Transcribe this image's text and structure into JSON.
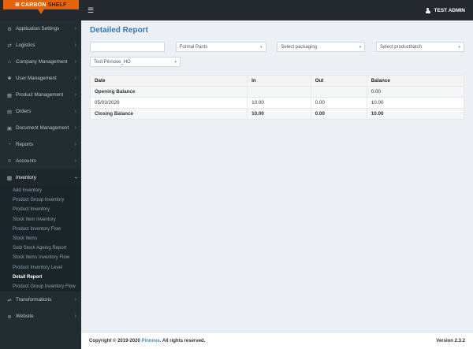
{
  "brand": {
    "carbon": "CARBON",
    "shelf": "SHELF"
  },
  "icons": {
    "hamburger": "☰",
    "caret": "▾",
    "logo_glyph": "▤"
  },
  "topbar": {
    "user_label": "TEST ADMIN"
  },
  "sidebar": {
    "chevron": "›",
    "items": [
      {
        "label": "Application Settings",
        "glyph": "⚙"
      },
      {
        "label": "Logistics",
        "glyph": "⇄"
      },
      {
        "label": "Company Management",
        "glyph": "⌂"
      },
      {
        "label": "User Management",
        "glyph": "☻"
      },
      {
        "label": "Product Management",
        "glyph": "▦"
      },
      {
        "label": "Orders",
        "glyph": "▤"
      },
      {
        "label": "Document Management",
        "glyph": "▣"
      },
      {
        "label": "Reports",
        "glyph": "◔"
      },
      {
        "label": "Accounts",
        "glyph": "¤"
      },
      {
        "label": "Inventory",
        "glyph": "▥"
      },
      {
        "label": "Transformations",
        "glyph": "⇌"
      },
      {
        "label": "Website",
        "glyph": "⊕"
      }
    ],
    "inventory_submenu": [
      "Add Inventory",
      "Product Group Inventory",
      "Product Inventory",
      "Stock Item Inventory",
      "Product Inventory Flow",
      "Stock Items",
      "Sold Stock Ageing Report",
      "Stock Items Inventory Flow",
      "Product Inventory Level",
      "Detail Report",
      "Product Group Inventory Flow"
    ]
  },
  "main": {
    "title": "Detailed Report",
    "filters": {
      "date_value": "",
      "product": "Formal Pants",
      "packaging": "Select packaging",
      "productbatch": "Select productbatch",
      "branch": "Test Pinnove_HO"
    },
    "table": {
      "headers": [
        "Date",
        "In",
        "Out",
        "Balance"
      ],
      "rows": [
        {
          "date": "Opening Balance",
          "in": "",
          "out": "",
          "balance": "0.00"
        },
        {
          "date": "05/03/2020",
          "in": "10.00",
          "out": "0.00",
          "balance": "10.00"
        },
        {
          "date": "Closing Balance",
          "in": "10.00",
          "out": "0.00",
          "balance": "10.00"
        }
      ]
    }
  },
  "footer": {
    "copyright_prefix": "Copyright © 2019-2020 ",
    "brand": "Pinnove",
    "copyright_suffix": ". All rights reserved.",
    "version_label": "Version",
    "version_value": "2.3.2"
  },
  "colors": {
    "accent_orange": "#e2650e",
    "link_blue": "#3c8dbc",
    "sidebar_dark": "#222d32"
  }
}
